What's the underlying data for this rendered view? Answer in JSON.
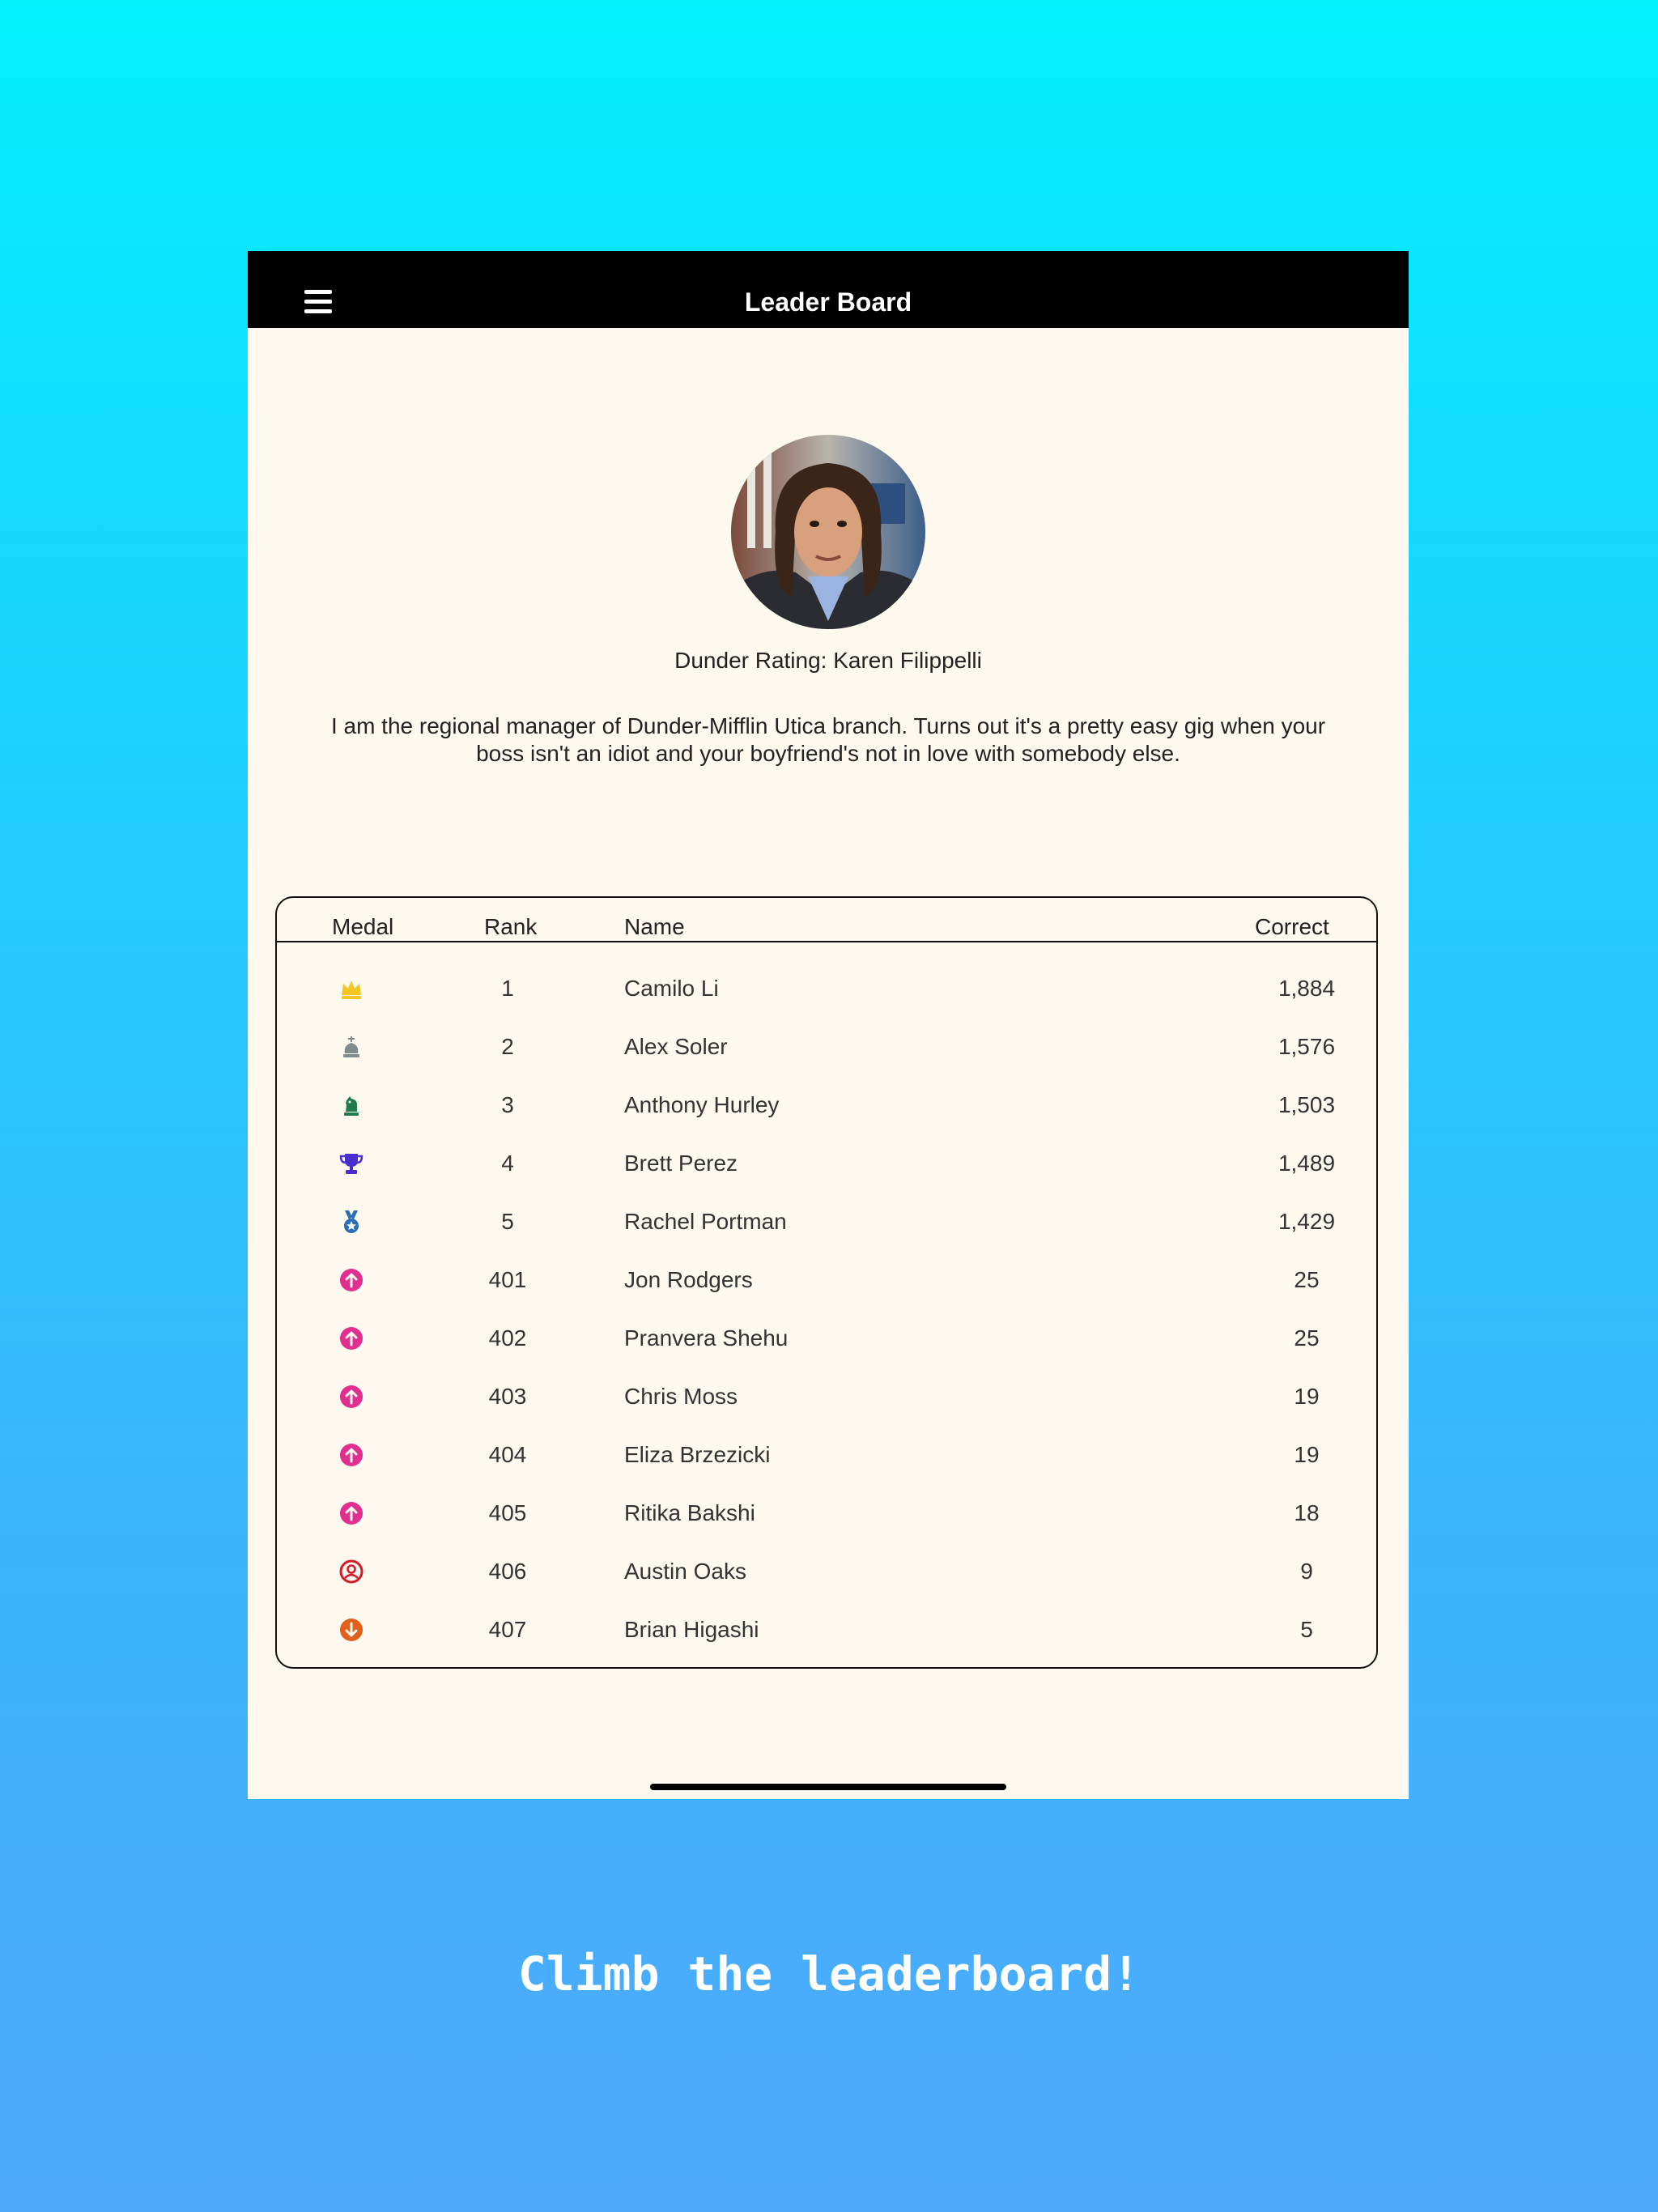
{
  "navbar": {
    "title": "Leader Board",
    "menu_icon": "hamburger-menu-icon"
  },
  "profile": {
    "rating_text": "Dunder Rating: Karen Filippelli",
    "bio": "I am the regional manager of Dunder-Mifflin Utica branch. Turns out it's a pretty easy gig when your boss isn't an idiot and your boyfriend's not in love with somebody else."
  },
  "table": {
    "headers": {
      "medal": "Medal",
      "rank": "Rank",
      "name": "Name",
      "correct": "Correct"
    },
    "rows": [
      {
        "medal": "crown-icon",
        "color": "#f5c623",
        "rank": "1",
        "name": "Camilo Li",
        "correct": "1,884"
      },
      {
        "medal": "chess-king-icon",
        "color": "#7f8c8d",
        "rank": "2",
        "name": "Alex Soler",
        "correct": "1,576"
      },
      {
        "medal": "chess-knight-icon",
        "color": "#1f7a4d",
        "rank": "3",
        "name": "Anthony Hurley",
        "correct": "1,503"
      },
      {
        "medal": "trophy-icon",
        "color": "#4a2fd0",
        "rank": "4",
        "name": "Brett Perez",
        "correct": "1,489"
      },
      {
        "medal": "medal-icon",
        "color": "#2a6fb5",
        "rank": "5",
        "name": "Rachel Portman",
        "correct": "1,429"
      },
      {
        "medal": "arrow-up-circle-icon",
        "color": "#e02f8e",
        "rank": "401",
        "name": "Jon Rodgers",
        "correct": "25"
      },
      {
        "medal": "arrow-up-circle-icon",
        "color": "#e02f8e",
        "rank": "402",
        "name": "Pranvera Shehu",
        "correct": "25"
      },
      {
        "medal": "arrow-up-circle-icon",
        "color": "#e02f8e",
        "rank": "403",
        "name": "Chris Moss",
        "correct": "19"
      },
      {
        "medal": "arrow-up-circle-icon",
        "color": "#e02f8e",
        "rank": "404",
        "name": "Eliza Brzezicki",
        "correct": "19"
      },
      {
        "medal": "arrow-up-circle-icon",
        "color": "#e02f8e",
        "rank": "405",
        "name": "Ritika Bakshi",
        "correct": "18"
      },
      {
        "medal": "user-circle-icon",
        "color": "#d11c2b",
        "rank": "406",
        "name": "Austin Oaks",
        "correct": "9"
      },
      {
        "medal": "arrow-down-circle-icon",
        "color": "#e0601c",
        "rank": "407",
        "name": "Brian Higashi",
        "correct": "5"
      }
    ]
  },
  "caption": "Climb the leaderboard!",
  "colors": {
    "background_top": "#02f1fd",
    "background_bottom": "#4fa9fc",
    "card_background": "#fdf9ee",
    "navbar": "#000000"
  }
}
